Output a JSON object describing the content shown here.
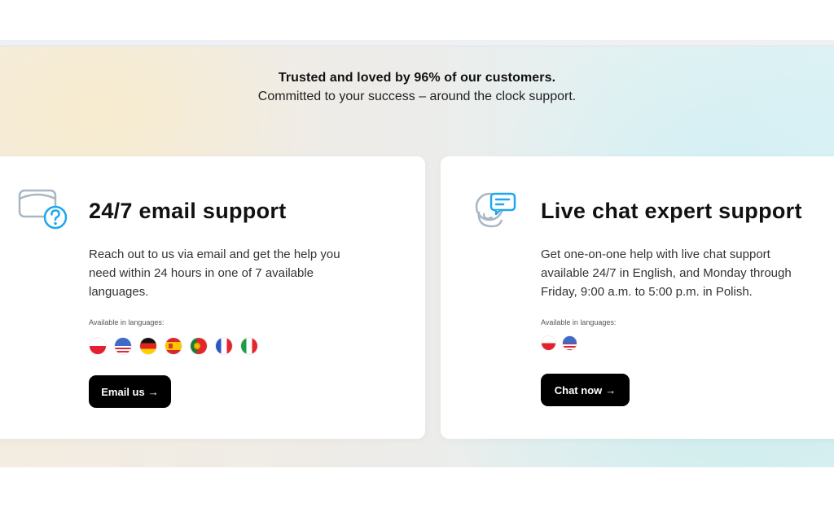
{
  "hero": {
    "headline": "Trusted and loved by 96% of our customers.",
    "subheadline": "Committed to your success – around the clock support."
  },
  "cards": [
    {
      "icon": "email-question-icon",
      "title": "24/7 email support",
      "description": "Reach out to us via email and get the help you need within 24 hours in one of 7 available languages.",
      "languages_label": "Available in languages:",
      "languages": [
        "Polish",
        "English (US)",
        "German",
        "Spanish",
        "Portuguese",
        "French",
        "Italian"
      ],
      "button_label": "Email us",
      "button_arrow": "→"
    },
    {
      "icon": "headset-chat-icon",
      "title": "Live chat expert support",
      "description": "Get one-on-one help with live chat support available 24/7 in English, and Monday through Friday, 9:00 a.m. to 5:00 p.m. in Polish.",
      "languages_label": "Available in languages:",
      "languages": [
        "Polish",
        "English (US)"
      ],
      "button_label": "Chat now",
      "button_arrow": "→"
    }
  ],
  "colors": {
    "accent_blue": "#1ea7f0",
    "icon_gray": "#a9b6c4",
    "button_bg": "#000000",
    "button_text": "#ffffff"
  }
}
